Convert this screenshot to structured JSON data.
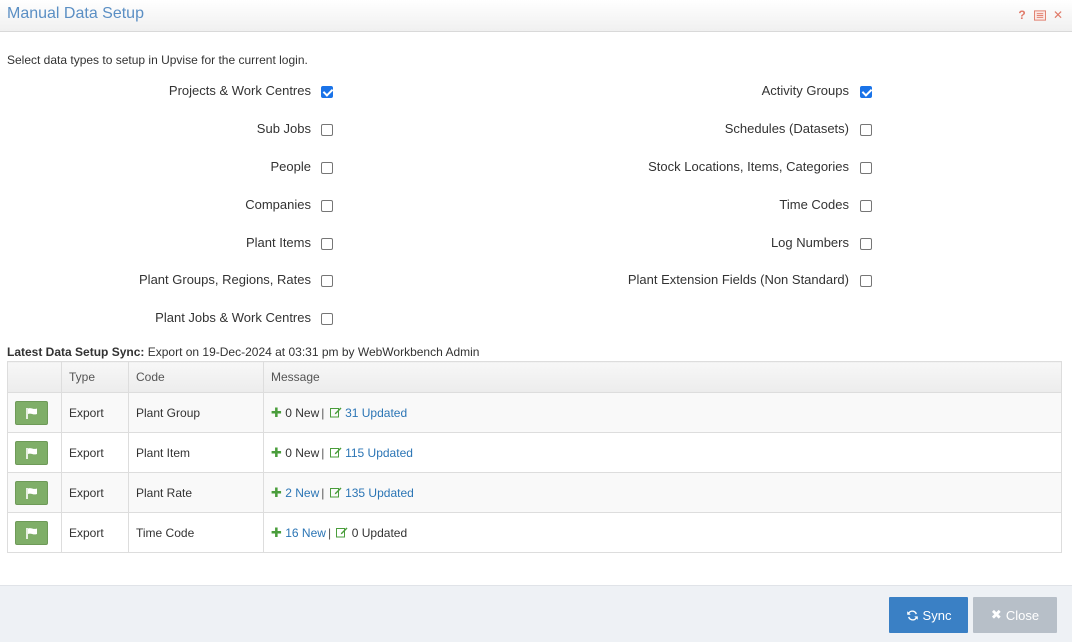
{
  "header": {
    "title": "Manual Data Setup",
    "help_icon": "question-icon",
    "list_icon": "list-icon",
    "close_icon": "close-icon"
  },
  "intro": "Select data types to setup in Upvise for the current login.",
  "options_left": [
    {
      "label": "Projects & Work Centres",
      "checked": true
    },
    {
      "label": "Sub Jobs",
      "checked": false
    },
    {
      "label": "People",
      "checked": false
    },
    {
      "label": "Companies",
      "checked": false
    },
    {
      "label": "Plant Items",
      "checked": false
    },
    {
      "label": "Plant Groups, Regions, Rates",
      "checked": false
    },
    {
      "label": "Plant Jobs & Work Centres",
      "checked": false
    }
  ],
  "options_right": [
    {
      "label": "Activity Groups",
      "checked": true
    },
    {
      "label": "Schedules (Datasets)",
      "checked": false
    },
    {
      "label": "Stock Locations, Items, Categories",
      "checked": false
    },
    {
      "label": "Time Codes",
      "checked": false
    },
    {
      "label": "Log Numbers",
      "checked": false
    },
    {
      "label": "Plant Extension Fields (Non Standard)",
      "checked": false
    }
  ],
  "latest": {
    "label": "Latest Data Setup Sync:",
    "text": "Export on 19-Dec-2024 at 03:31 pm by WebWorkbench Admin"
  },
  "table": {
    "columns": [
      "",
      "Type",
      "Code",
      "Message"
    ],
    "rows": [
      {
        "type": "Export",
        "code": "Plant Group",
        "new": "0 New",
        "new_link": false,
        "updated": "31 Updated",
        "updated_link": true
      },
      {
        "type": "Export",
        "code": "Plant Item",
        "new": "0 New",
        "new_link": false,
        "updated": "115 Updated",
        "updated_link": true
      },
      {
        "type": "Export",
        "code": "Plant Rate",
        "new": "2 New",
        "new_link": true,
        "updated": "135 Updated",
        "updated_link": true
      },
      {
        "type": "Export",
        "code": "Time Code",
        "new": "16 New",
        "new_link": true,
        "updated": "0 Updated",
        "updated_link": false
      }
    ]
  },
  "footer": {
    "sync_label": "Sync",
    "close_label": "Close"
  },
  "colors": {
    "accent": "#3a80c5",
    "title": "#5b8fc4",
    "flag": "#7fae68",
    "plus": "#4a9d3b",
    "link": "#2b75b5"
  }
}
